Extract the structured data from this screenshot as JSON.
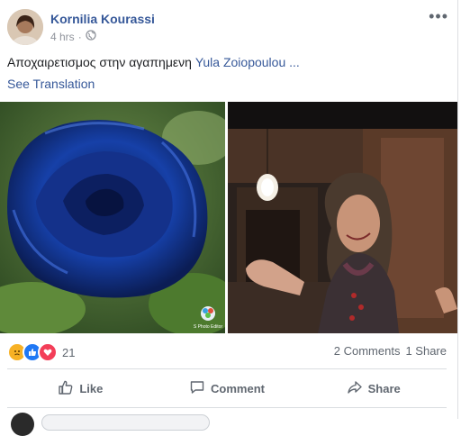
{
  "post": {
    "author": "Kornilia Kourassi",
    "time": "4 hrs",
    "privacy_separator": "·",
    "body_text": "Αποχαιρετισμος στην αγαπημενη",
    "mention": "Yula Zoiopoulou",
    "ellipsis": "...",
    "see_translation": "See Translation"
  },
  "stats": {
    "reaction_count": "21",
    "comments": "2 Comments",
    "shares": "1 Share"
  },
  "actions": {
    "like": "Like",
    "comment": "Comment",
    "share": "Share"
  },
  "photo1": {
    "watermark": "S Photo Editor"
  },
  "colors": {
    "link": "#365899",
    "meta": "#90949c",
    "like": "#2078f4",
    "love": "#f33e58",
    "sad": "#f7b125"
  }
}
